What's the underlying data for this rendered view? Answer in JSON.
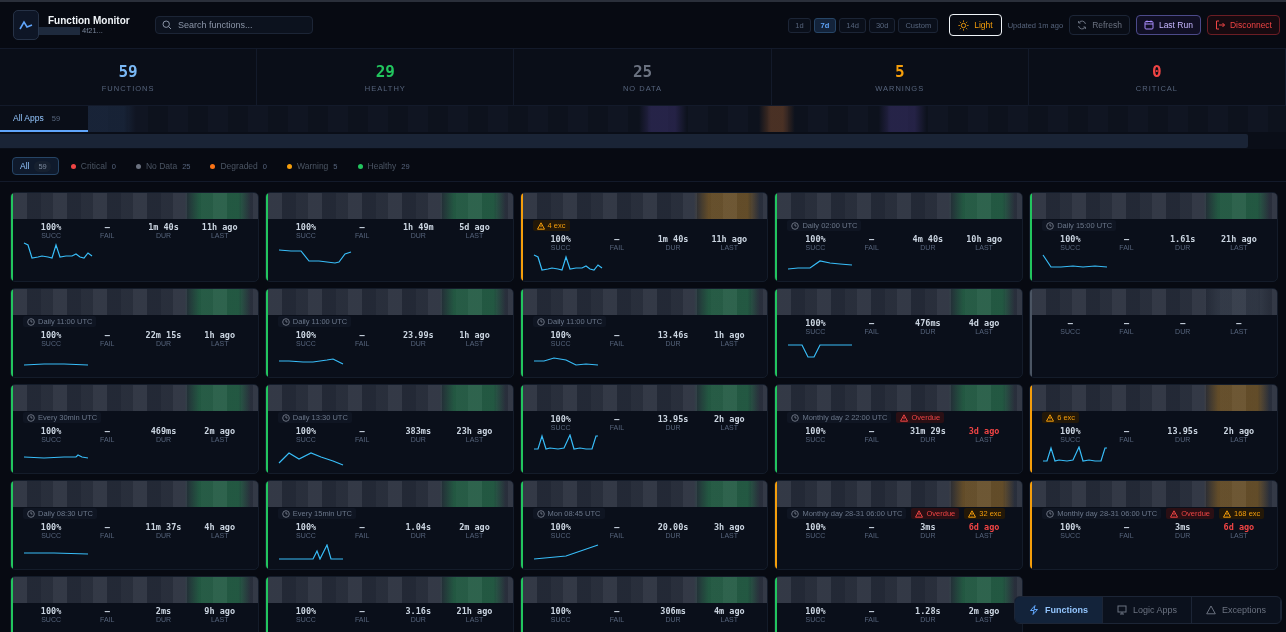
{
  "header": {
    "title": "Function Monitor",
    "subtitle": "4f21...",
    "search": {
      "placeholder": "Search functions..."
    },
    "ranges": [
      {
        "label": "1d",
        "selected": false
      },
      {
        "label": "7d",
        "selected": true
      },
      {
        "label": "14d",
        "selected": false
      },
      {
        "label": "30d",
        "selected": false
      },
      {
        "label": "Custom",
        "selected": false
      }
    ],
    "theme_button": "Light",
    "updated": "Updated 1m ago",
    "refresh": "Refresh",
    "last_run": "Last Run",
    "disconnect": "Disconnect"
  },
  "stats": [
    {
      "value": "59",
      "label": "FUNCTIONS",
      "color": "#7ab8f5"
    },
    {
      "value": "29",
      "label": "HEALTHY",
      "color": "#22c55e"
    },
    {
      "value": "25",
      "label": "NO DATA",
      "color": "#6b7280"
    },
    {
      "value": "5",
      "label": "WARNINGS",
      "color": "#f59e0b"
    },
    {
      "value": "0",
      "label": "CRITICAL",
      "color": "#ef4444"
    }
  ],
  "app_tabs": [
    {
      "label": "All Apps",
      "count": "59",
      "selected": true
    }
  ],
  "filters": [
    {
      "label": "All",
      "count": "59",
      "selected": true
    },
    {
      "label": "Critical",
      "count": "0",
      "selected": false,
      "color": "#ef4444"
    },
    {
      "label": "No Data",
      "count": "25",
      "selected": false,
      "color": "#6b7280"
    },
    {
      "label": "Degraded",
      "count": "0",
      "selected": false,
      "color": "#f97316"
    },
    {
      "label": "Warning",
      "count": "5",
      "selected": false,
      "color": "#f59e0b"
    },
    {
      "label": "Healthy",
      "count": "29",
      "selected": false,
      "color": "#22c55e"
    }
  ],
  "cards": [
    {
      "color": "#22c55e",
      "late": false,
      "sparkline": true,
      "stats": [
        {
          "value": "100%",
          "label": "SUCC"
        },
        {
          "value": "–",
          "label": "FAIL"
        },
        {
          "value": "1m 40s",
          "label": "DUR"
        },
        {
          "value": "11h ago",
          "label": "LAST"
        }
      ]
    },
    {
      "color": "#22c55e",
      "late": false,
      "sparkline": true,
      "stats": [
        {
          "value": "100%",
          "label": "SUCC"
        },
        {
          "value": "–",
          "label": "FAIL"
        },
        {
          "value": "1h 49m",
          "label": "DUR"
        },
        {
          "value": "5d ago",
          "label": "LAST"
        }
      ]
    },
    {
      "color": "#f59e0b",
      "late": false,
      "sparkline": true,
      "exceptions": "4 exc",
      "stats": [
        {
          "value": "100%",
          "label": "SUCC"
        },
        {
          "value": "–",
          "label": "FAIL"
        },
        {
          "value": "1m 40s",
          "label": "DUR"
        },
        {
          "value": "11h ago",
          "label": "LAST"
        }
      ]
    },
    {
      "color": "#22c55e",
      "late": false,
      "sparkline": true,
      "schedule": "Daily 02:00 UTC",
      "stats": [
        {
          "value": "100%",
          "label": "SUCC"
        },
        {
          "value": "–",
          "label": "FAIL"
        },
        {
          "value": "4m 40s",
          "label": "DUR"
        },
        {
          "value": "10h ago",
          "label": "LAST"
        }
      ]
    },
    {
      "color": "#22c55e",
      "late": false,
      "sparkline": true,
      "schedule": "Daily 15:00 UTC",
      "stats": [
        {
          "value": "100%",
          "label": "SUCC"
        },
        {
          "value": "–",
          "label": "FAIL"
        },
        {
          "value": "1.61s",
          "label": "DUR"
        },
        {
          "value": "21h ago",
          "label": "LAST"
        }
      ]
    },
    {
      "color": "#22c55e",
      "late": false,
      "sparkline": true,
      "schedule": "Daily 11:00 UTC",
      "stats": [
        {
          "value": "100%",
          "label": "SUCC"
        },
        {
          "value": "–",
          "label": "FAIL"
        },
        {
          "value": "22m 15s",
          "label": "DUR"
        },
        {
          "value": "1h ago",
          "label": "LAST"
        }
      ]
    },
    {
      "color": "#22c55e",
      "late": false,
      "sparkline": true,
      "schedule": "Daily 11:00 UTC",
      "stats": [
        {
          "value": "100%",
          "label": "SUCC"
        },
        {
          "value": "–",
          "label": "FAIL"
        },
        {
          "value": "23.99s",
          "label": "DUR"
        },
        {
          "value": "1h ago",
          "label": "LAST"
        }
      ]
    },
    {
      "color": "#22c55e",
      "late": false,
      "sparkline": true,
      "schedule": "Daily 11:00 UTC",
      "stats": [
        {
          "value": "100%",
          "label": "SUCC"
        },
        {
          "value": "–",
          "label": "FAIL"
        },
        {
          "value": "13.46s",
          "label": "DUR"
        },
        {
          "value": "1h ago",
          "label": "LAST"
        }
      ]
    },
    {
      "color": "#22c55e",
      "late": false,
      "sparkline": true,
      "stats": [
        {
          "value": "100%",
          "label": "SUCC"
        },
        {
          "value": "–",
          "label": "FAIL"
        },
        {
          "value": "476ms",
          "label": "DUR"
        },
        {
          "value": "4d ago",
          "label": "LAST"
        }
      ]
    },
    {
      "color": "#4b5563",
      "late": false,
      "sparkline": false,
      "stats": [
        {
          "value": "–",
          "label": "SUCC"
        },
        {
          "value": "–",
          "label": "FAIL"
        },
        {
          "value": "–",
          "label": "DUR"
        },
        {
          "value": "–",
          "label": "LAST"
        }
      ]
    },
    {
      "color": "#22c55e",
      "late": false,
      "sparkline": true,
      "schedule": "Every 30min UTC",
      "stats": [
        {
          "value": "100%",
          "label": "SUCC"
        },
        {
          "value": "–",
          "label": "FAIL"
        },
        {
          "value": "469ms",
          "label": "DUR"
        },
        {
          "value": "2m ago",
          "label": "LAST"
        }
      ]
    },
    {
      "color": "#22c55e",
      "late": false,
      "sparkline": true,
      "schedule": "Daily 13:30 UTC",
      "stats": [
        {
          "value": "100%",
          "label": "SUCC"
        },
        {
          "value": "–",
          "label": "FAIL"
        },
        {
          "value": "383ms",
          "label": "DUR"
        },
        {
          "value": "23h ago",
          "label": "LAST"
        }
      ]
    },
    {
      "color": "#22c55e",
      "late": false,
      "sparkline": true,
      "stats": [
        {
          "value": "100%",
          "label": "SUCC"
        },
        {
          "value": "–",
          "label": "FAIL"
        },
        {
          "value": "13.95s",
          "label": "DUR"
        },
        {
          "value": "2h ago",
          "label": "LAST"
        }
      ]
    },
    {
      "color": "#22c55e",
      "late": true,
      "sparkline": false,
      "schedule": "Monthly day 2 22:00 UTC",
      "overdue": "Overdue",
      "stats": [
        {
          "value": "100%",
          "label": "SUCC"
        },
        {
          "value": "–",
          "label": "FAIL"
        },
        {
          "value": "31m 29s",
          "label": "DUR"
        },
        {
          "value": "3d ago",
          "label": "LAST"
        }
      ]
    },
    {
      "color": "#f59e0b",
      "late": false,
      "sparkline": true,
      "exceptions": "6 exc",
      "stats": [
        {
          "value": "100%",
          "label": "SUCC"
        },
        {
          "value": "–",
          "label": "FAIL"
        },
        {
          "value": "13.95s",
          "label": "DUR"
        },
        {
          "value": "2h ago",
          "label": "LAST"
        }
      ]
    },
    {
      "color": "#22c55e",
      "late": false,
      "sparkline": true,
      "schedule": "Daily 08:30 UTC",
      "stats": [
        {
          "value": "100%",
          "label": "SUCC"
        },
        {
          "value": "–",
          "label": "FAIL"
        },
        {
          "value": "11m 37s",
          "label": "DUR"
        },
        {
          "value": "4h ago",
          "label": "LAST"
        }
      ]
    },
    {
      "color": "#22c55e",
      "late": false,
      "sparkline": true,
      "schedule": "Every 15min UTC",
      "stats": [
        {
          "value": "100%",
          "label": "SUCC"
        },
        {
          "value": "–",
          "label": "FAIL"
        },
        {
          "value": "1.04s",
          "label": "DUR"
        },
        {
          "value": "2m ago",
          "label": "LAST"
        }
      ]
    },
    {
      "color": "#22c55e",
      "late": false,
      "sparkline": true,
      "schedule": "Mon 08:45 UTC",
      "stats": [
        {
          "value": "100%",
          "label": "SUCC"
        },
        {
          "value": "–",
          "label": "FAIL"
        },
        {
          "value": "20.00s",
          "label": "DUR"
        },
        {
          "value": "3h ago",
          "label": "LAST"
        }
      ]
    },
    {
      "color": "#f59e0b",
      "late": true,
      "sparkline": false,
      "schedule": "Monthly day 28-31 06:00 UTC",
      "overdue": "Overdue",
      "exceptions": "32 exc",
      "stats": [
        {
          "value": "100%",
          "label": "SUCC"
        },
        {
          "value": "–",
          "label": "FAIL"
        },
        {
          "value": "3ms",
          "label": "DUR"
        },
        {
          "value": "6d ago",
          "label": "LAST"
        }
      ]
    },
    {
      "color": "#f59e0b",
      "late": true,
      "sparkline": false,
      "schedule": "Monthly day 28-31 06:00 UTC",
      "overdue": "Overdue",
      "exceptions": "168 exc",
      "stats": [
        {
          "value": "100%",
          "label": "SUCC"
        },
        {
          "value": "–",
          "label": "FAIL"
        },
        {
          "value": "3ms",
          "label": "DUR"
        },
        {
          "value": "6d ago",
          "label": "LAST"
        }
      ]
    },
    {
      "color": "#22c55e",
      "late": false,
      "sparkline": false,
      "stats": [
        {
          "value": "100%",
          "label": "SUCC"
        },
        {
          "value": "–",
          "label": "FAIL"
        },
        {
          "value": "2ms",
          "label": "DUR"
        },
        {
          "value": "9h ago",
          "label": "LAST"
        }
      ]
    },
    {
      "color": "#22c55e",
      "late": false,
      "sparkline": false,
      "stats": [
        {
          "value": "100%",
          "label": "SUCC"
        },
        {
          "value": "–",
          "label": "FAIL"
        },
        {
          "value": "3.16s",
          "label": "DUR"
        },
        {
          "value": "21h ago",
          "label": "LAST"
        }
      ]
    },
    {
      "color": "#22c55e",
      "late": false,
      "sparkline": false,
      "stats": [
        {
          "value": "100%",
          "label": "SUCC"
        },
        {
          "value": "–",
          "label": "FAIL"
        },
        {
          "value": "306ms",
          "label": "DUR"
        },
        {
          "value": "4m ago",
          "label": "LAST"
        }
      ]
    },
    {
      "color": "#22c55e",
      "late": false,
      "sparkline": false,
      "stats": [
        {
          "value": "100%",
          "label": "SUCC"
        },
        {
          "value": "–",
          "label": "FAIL"
        },
        {
          "value": "1.28s",
          "label": "DUR"
        },
        {
          "value": "2m ago",
          "label": "LAST"
        }
      ]
    }
  ],
  "bottom_nav": [
    {
      "label": "Functions",
      "selected": true
    },
    {
      "label": "Logic Apps",
      "selected": false
    },
    {
      "label": "Exceptions",
      "selected": false
    }
  ]
}
